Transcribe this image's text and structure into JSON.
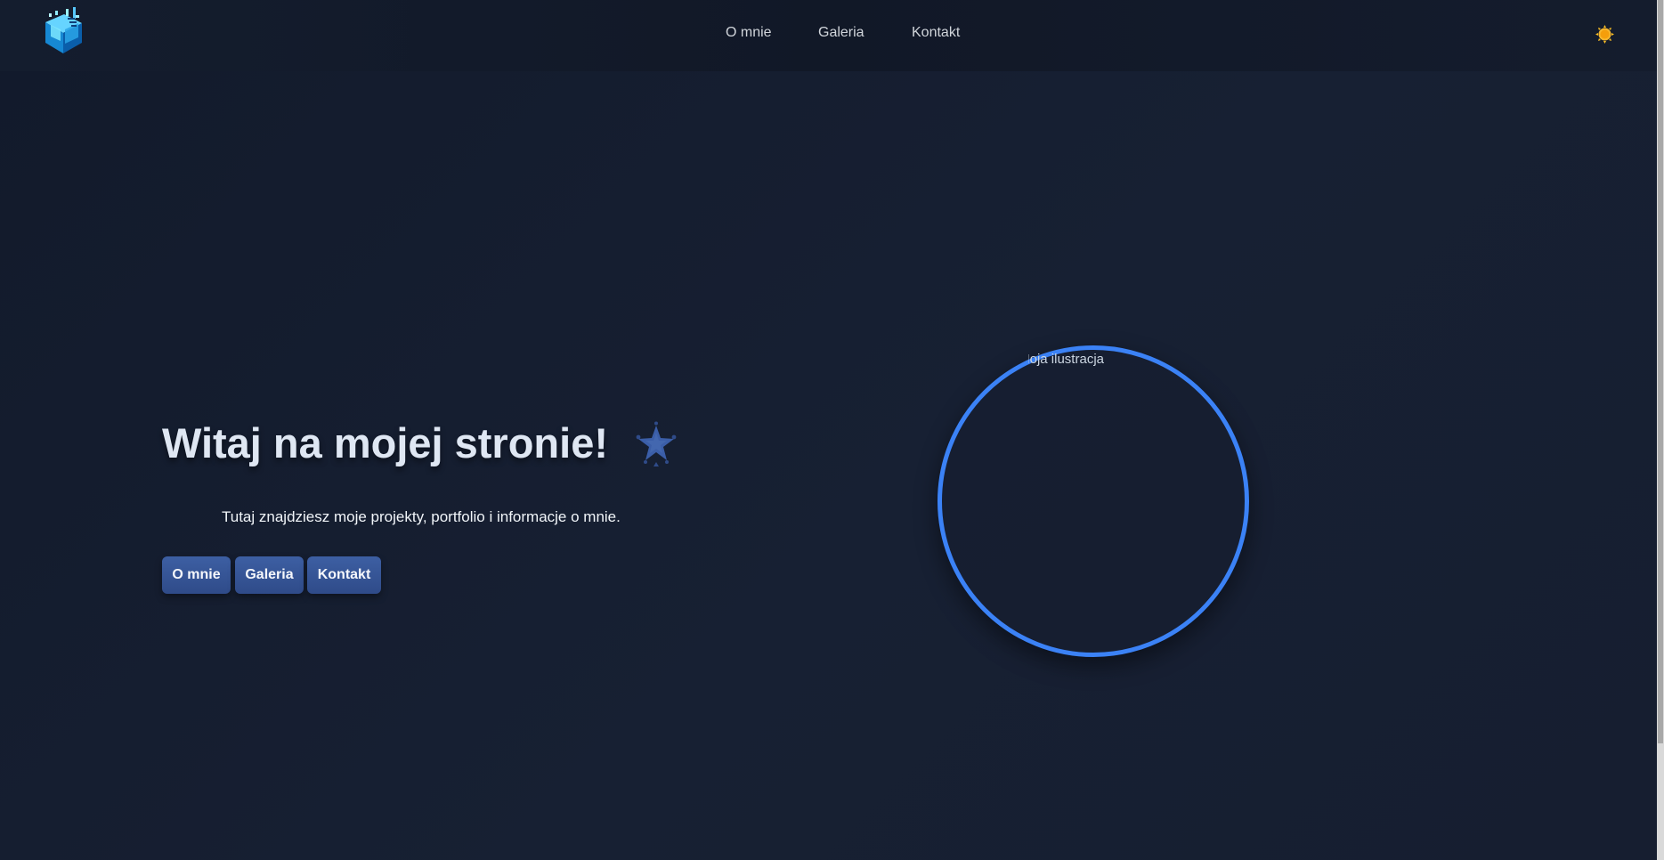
{
  "nav": {
    "about": "O mnie",
    "gallery": "Galeria",
    "contact": "Kontakt"
  },
  "hero": {
    "title": "Witaj na mojej stronie!",
    "subtitle": "Tutaj znajdziesz moje projekty, portfolio i informacje o mnie.",
    "buttons": {
      "about": "O mnie",
      "gallery": "Galeria",
      "contact": "Kontakt"
    }
  },
  "illustration": {
    "alt_text": "Moja ilustracja"
  },
  "icons": {
    "logo": "cube-logo-icon",
    "theme_toggle": "sun-icon",
    "decoration": "star-icon"
  },
  "colors": {
    "background": "#151d2e",
    "accent": "#3b82f6",
    "button": "#37559a",
    "sun": "#f7b72e"
  }
}
